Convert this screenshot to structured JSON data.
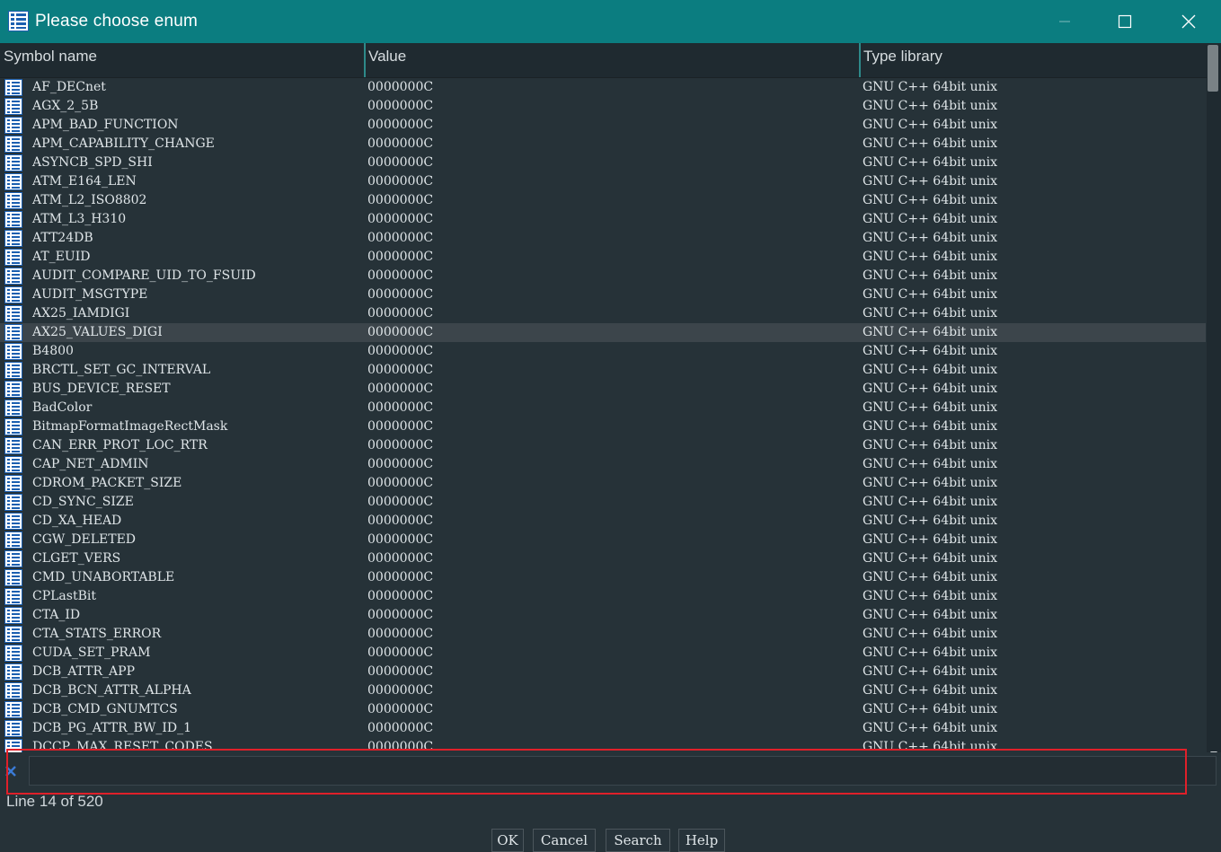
{
  "window": {
    "title": "Please choose enum",
    "icon": "enum-list-icon",
    "controls": [
      "minimize-icon",
      "maximize-icon",
      "close-icon"
    ]
  },
  "columns": {
    "name": "Symbol name",
    "value": "Value",
    "library": "Type library"
  },
  "rows": [
    {
      "name": "AF_DECnet",
      "value": "0000000C",
      "library": "GNU C++ 64bit unix"
    },
    {
      "name": "AGX_2_5B",
      "value": "0000000C",
      "library": "GNU C++ 64bit unix"
    },
    {
      "name": "APM_BAD_FUNCTION",
      "value": "0000000C",
      "library": "GNU C++ 64bit unix"
    },
    {
      "name": "APM_CAPABILITY_CHANGE",
      "value": "0000000C",
      "library": "GNU C++ 64bit unix"
    },
    {
      "name": "ASYNCB_SPD_SHI",
      "value": "0000000C",
      "library": "GNU C++ 64bit unix"
    },
    {
      "name": "ATM_E164_LEN",
      "value": "0000000C",
      "library": "GNU C++ 64bit unix"
    },
    {
      "name": "ATM_L2_ISO8802",
      "value": "0000000C",
      "library": "GNU C++ 64bit unix"
    },
    {
      "name": "ATM_L3_H310",
      "value": "0000000C",
      "library": "GNU C++ 64bit unix"
    },
    {
      "name": "ATT24DB",
      "value": "0000000C",
      "library": "GNU C++ 64bit unix"
    },
    {
      "name": "AT_EUID",
      "value": "0000000C",
      "library": "GNU C++ 64bit unix"
    },
    {
      "name": "AUDIT_COMPARE_UID_TO_FSUID",
      "value": "0000000C",
      "library": "GNU C++ 64bit unix"
    },
    {
      "name": "AUDIT_MSGTYPE",
      "value": "0000000C",
      "library": "GNU C++ 64bit unix"
    },
    {
      "name": "AX25_IAMDIGI",
      "value": "0000000C",
      "library": "GNU C++ 64bit unix"
    },
    {
      "name": "AX25_VALUES_DIGI",
      "value": "0000000C",
      "library": "GNU C++ 64bit unix",
      "selected": true
    },
    {
      "name": "B4800",
      "value": "0000000C",
      "library": "GNU C++ 64bit unix"
    },
    {
      "name": "BRCTL_SET_GC_INTERVAL",
      "value": "0000000C",
      "library": "GNU C++ 64bit unix"
    },
    {
      "name": "BUS_DEVICE_RESET",
      "value": "0000000C",
      "library": "GNU C++ 64bit unix"
    },
    {
      "name": "BadColor",
      "value": "0000000C",
      "library": "GNU C++ 64bit unix"
    },
    {
      "name": "BitmapFormatImageRectMask",
      "value": "0000000C",
      "library": "GNU C++ 64bit unix"
    },
    {
      "name": "CAN_ERR_PROT_LOC_RTR",
      "value": "0000000C",
      "library": "GNU C++ 64bit unix"
    },
    {
      "name": "CAP_NET_ADMIN",
      "value": "0000000C",
      "library": "GNU C++ 64bit unix"
    },
    {
      "name": "CDROM_PACKET_SIZE",
      "value": "0000000C",
      "library": "GNU C++ 64bit unix"
    },
    {
      "name": "CD_SYNC_SIZE",
      "value": "0000000C",
      "library": "GNU C++ 64bit unix"
    },
    {
      "name": "CD_XA_HEAD",
      "value": "0000000C",
      "library": "GNU C++ 64bit unix"
    },
    {
      "name": "CGW_DELETED",
      "value": "0000000C",
      "library": "GNU C++ 64bit unix"
    },
    {
      "name": "CLGET_VERS",
      "value": "0000000C",
      "library": "GNU C++ 64bit unix"
    },
    {
      "name": "CMD_UNABORTABLE",
      "value": "0000000C",
      "library": "GNU C++ 64bit unix"
    },
    {
      "name": "CPLastBit",
      "value": "0000000C",
      "library": "GNU C++ 64bit unix"
    },
    {
      "name": "CTA_ID",
      "value": "0000000C",
      "library": "GNU C++ 64bit unix"
    },
    {
      "name": "CTA_STATS_ERROR",
      "value": "0000000C",
      "library": "GNU C++ 64bit unix"
    },
    {
      "name": "CUDA_SET_PRAM",
      "value": "0000000C",
      "library": "GNU C++ 64bit unix"
    },
    {
      "name": "DCB_ATTR_APP",
      "value": "0000000C",
      "library": "GNU C++ 64bit unix"
    },
    {
      "name": "DCB_BCN_ATTR_ALPHA",
      "value": "0000000C",
      "library": "GNU C++ 64bit unix"
    },
    {
      "name": "DCB_CMD_GNUMTCS",
      "value": "0000000C",
      "library": "GNU C++ 64bit unix"
    },
    {
      "name": "DCB_PG_ATTR_BW_ID_1",
      "value": "0000000C",
      "library": "GNU C++ 64bit unix"
    },
    {
      "name": "DCCP_MAX_RESET_CODES",
      "value": "0000000C",
      "library": "GNU C++ 64bit unix"
    }
  ],
  "filter": {
    "value": "",
    "clear_icon": "clear-filter-icon"
  },
  "status": "Line 14 of 520",
  "buttons": {
    "ok": "OK",
    "cancel": "Cancel",
    "search": "Search",
    "help": "Help"
  },
  "colors": {
    "titlebar": "#0b7d80",
    "background": "#263238",
    "header": "#1f2a30",
    "selected_row": "#3c454b",
    "highlight_box": "#e0202a"
  }
}
